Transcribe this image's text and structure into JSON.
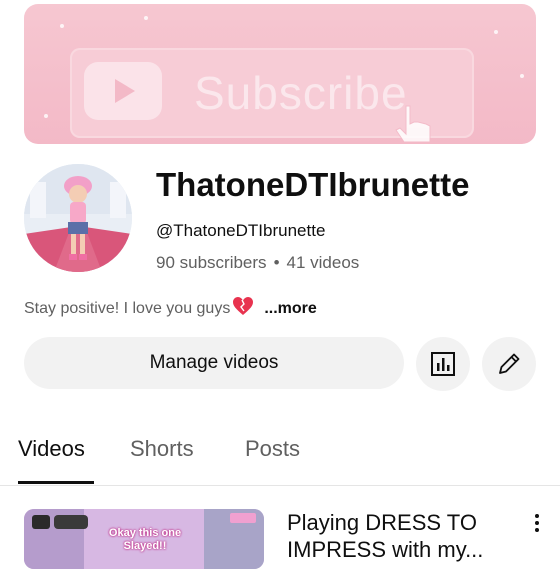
{
  "banner": {
    "subscribe_text": "Subscribe"
  },
  "channel": {
    "name": "ThatoneDTIbrunette",
    "handle": "@ThatoneDTIbrunette",
    "subscribers": "90 subscribers",
    "separator": "•",
    "videos": "41 videos",
    "description": "Stay positive! I love you guys",
    "more_label": "...more"
  },
  "actions": {
    "manage_videos_label": "Manage videos",
    "analytics_icon": "analytics-icon",
    "edit_icon": "pencil-icon"
  },
  "tabs": [
    {
      "label": "Videos",
      "active": true
    },
    {
      "label": "Shorts",
      "active": false
    },
    {
      "label": "Posts",
      "active": false
    }
  ],
  "video": {
    "title": "Playing DRESS TO IMPRESS with my...",
    "thumbnail_text": "Okay this one Slayed!!"
  },
  "colors": {
    "banner_pink": "#f3b9c7",
    "button_bg": "#f2f2f2",
    "text_primary": "#0f0f0f",
    "text_secondary": "#606060"
  }
}
